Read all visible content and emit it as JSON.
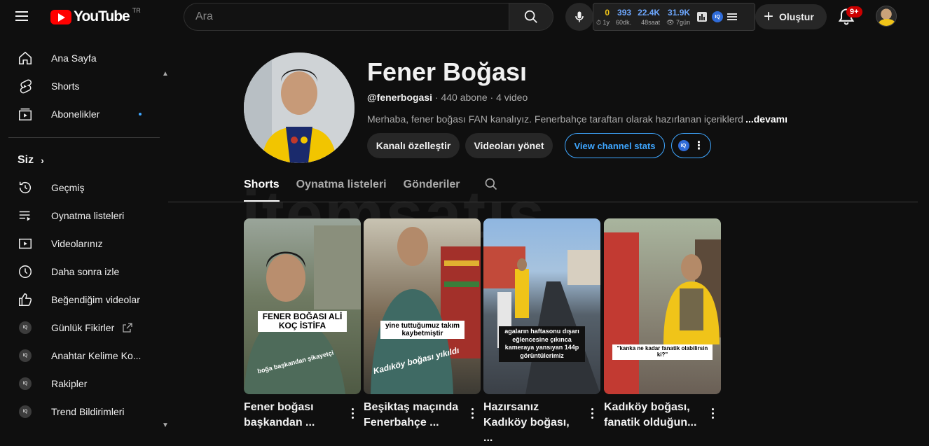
{
  "header": {
    "logo_text": "YouTube",
    "country_code": "TR",
    "search_placeholder": "Ara",
    "create_label": "Oluştur",
    "notifications_badge": "9+",
    "stats": [
      {
        "value": "0",
        "label": "1y",
        "color": "#f0c419"
      },
      {
        "value": "393",
        "label": "60dk.",
        "color": "#6ea8ff"
      },
      {
        "value": "22.4K",
        "label": "48saat",
        "color": "#6ea8ff"
      },
      {
        "value": "31.9K",
        "label": "7gün",
        "color": "#6ea8ff"
      }
    ],
    "iq_label": "IQ"
  },
  "sidebar": {
    "main": [
      {
        "label": "Ana Sayfa",
        "icon": "home-icon"
      },
      {
        "label": "Shorts",
        "icon": "shorts-icon"
      },
      {
        "label": "Abonelikler",
        "icon": "subscriptions-icon"
      }
    ],
    "you_label": "Siz",
    "you_items": [
      {
        "label": "Geçmiş",
        "icon": "history-icon"
      },
      {
        "label": "Oynatma listeleri",
        "icon": "playlists-icon"
      },
      {
        "label": "Videolarınız",
        "icon": "your-videos-icon"
      },
      {
        "label": "Daha sonra izle",
        "icon": "watch-later-icon"
      },
      {
        "label": "Beğendiğim videolar",
        "icon": "liked-icon"
      },
      {
        "label": "Günlük Fikirler",
        "icon": "iq-icon"
      },
      {
        "label": "Anahtar Kelime Ko...",
        "icon": "iq-icon"
      },
      {
        "label": "Rakipler",
        "icon": "iq-icon"
      },
      {
        "label": "Trend Bildirimleri",
        "icon": "iq-icon"
      }
    ]
  },
  "channel": {
    "name": "Fener Boğası",
    "handle": "@fenerbogasi",
    "subscribers": "440 abone",
    "videos": "4 video",
    "description": "Merhaba, fener boğası FAN kanalıyız. Fenerbahçe taraftarı olarak hazırlanan içeriklerde",
    "more_label": "...devamı",
    "buttons": {
      "customize": "Kanalı özelleştir",
      "manage": "Videoları yönet",
      "stats": "View channel stats"
    }
  },
  "tabs": [
    "Shorts",
    "Oynatma listeleri",
    "Gönderiler"
  ],
  "watermark": "itemsatış",
  "shorts": [
    {
      "title_line1": "Fener boğası",
      "title_line2": "başkandan ...",
      "caption": "FENER BOĞASI ALİ KOÇ İSTİFA",
      "overlay": "boğa başkandan şikayetçi"
    },
    {
      "title_line1": "Beşiktaş maçında",
      "title_line2": "Fenerbahçe ...",
      "caption": "yine tuttuğumuz takım kaybetmiştir",
      "overlay": "Kadıköy boğası yıkıldı"
    },
    {
      "title_line1": "Hazırsanız",
      "title_line2": "Kadıköy boğası, ...",
      "caption": "agaların haftasonu dışarı eğlencesine çıkınca kameraya yansıyan 144p görüntülerimiz",
      "overlay": ""
    },
    {
      "title_line1": "Kadıköy boğası,",
      "title_line2": "fanatik olduğun...",
      "caption": "\"kanka ne kadar fanatik olabilirsin ki?\"",
      "overlay": ""
    }
  ]
}
